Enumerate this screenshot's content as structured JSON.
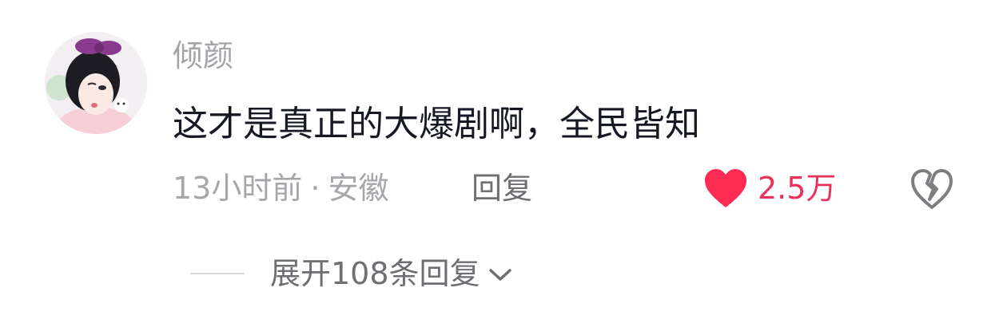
{
  "comment": {
    "username": "倾颜",
    "text": "这才是真正的大爆剧啊，全民皆知",
    "time": "13小时前",
    "separator": "·",
    "location": "安徽",
    "reply_label": "回复",
    "like_count": "2.5万",
    "liked": true,
    "expand_replies_label": "展开108条回复"
  },
  "icons": {
    "like": "heart-icon",
    "dislike": "broken-heart-icon",
    "expand": "chevron-down-icon"
  },
  "colors": {
    "like": "#fe2c55",
    "username": "#a3a3a8",
    "text": "#161823",
    "meta": "#a6a6ab"
  }
}
